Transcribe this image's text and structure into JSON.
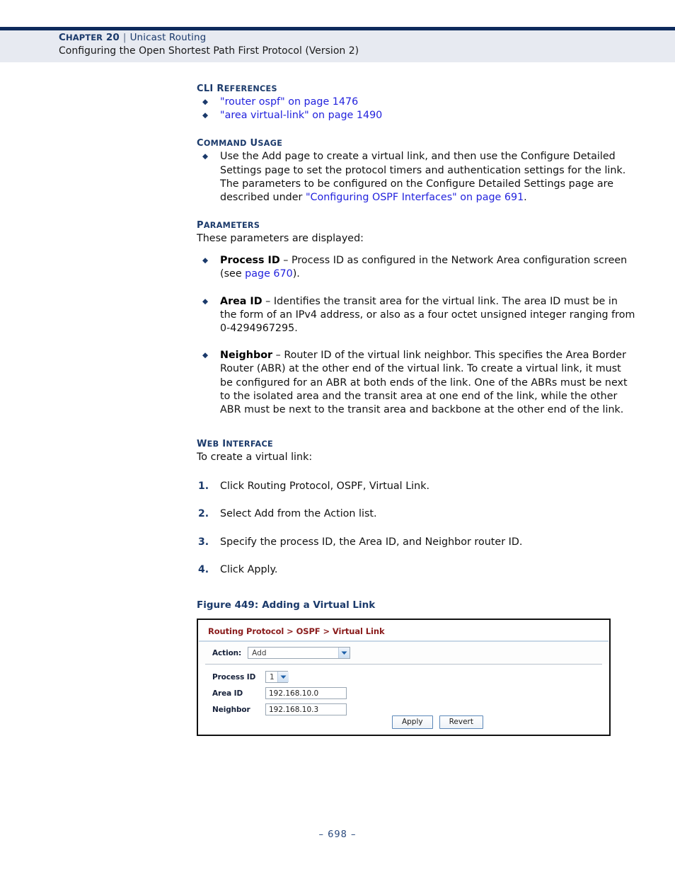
{
  "header": {
    "chapter_label": "CHAPTER 20",
    "separator": "|",
    "topic": "Unicast Routing",
    "subtitle": "Configuring the Open Shortest Path First Protocol (Version 2)"
  },
  "sections": {
    "cli_references": {
      "heading": "CLI REFERENCES",
      "items": [
        "\"router ospf\" on page 1476",
        "\"area virtual-link\" on page 1490"
      ]
    },
    "command_usage": {
      "heading": "COMMAND USAGE",
      "item_text_before": "Use the Add page to create a virtual link, and then use the Configure Detailed Settings page to set the protocol timers and authentication settings for the link. The parameters to be configured on the Configure Detailed Settings page are described under ",
      "item_link": "\"Configuring OSPF Interfaces\" on page 691",
      "item_text_after": "."
    },
    "parameters": {
      "heading": "PARAMETERS",
      "intro": "These parameters are displayed:",
      "items": [
        {
          "term": "Process ID",
          "text_before": " – Process ID as configured in the Network Area configuration screen (see ",
          "link": "page 670",
          "text_after": ")."
        },
        {
          "term": "Area ID",
          "text_before": " – Identifies the transit area for the virtual link. The area ID must be in the form of an IPv4 address, or also as a four octet unsigned integer ranging from 0-4294967295.",
          "link": "",
          "text_after": ""
        },
        {
          "term": "Neighbor",
          "text_before": " – Router ID of the virtual link neighbor. This specifies the Area Border Router (ABR) at the other end of the virtual link. To create a virtual link, it must be configured for an ABR at both ends of the link. One of the ABRs must be next to the isolated area and the transit area at one end of the link, while the other ABR must be next to the transit area and backbone at the other end of the link.",
          "link": "",
          "text_after": ""
        }
      ]
    },
    "web_interface": {
      "heading": "WEB INTERFACE",
      "intro": "To create a virtual link:",
      "steps": [
        {
          "num": "1.",
          "text": "Click Routing Protocol, OSPF, Virtual Link."
        },
        {
          "num": "2.",
          "text": "Select Add from the Action list."
        },
        {
          "num": "3.",
          "text": "Specify the process ID, the Area ID, and Neighbor router ID."
        },
        {
          "num": "4.",
          "text": "Click Apply."
        }
      ]
    }
  },
  "figure": {
    "caption_number": "Figure 449:",
    "caption_title": "Adding a Virtual Link",
    "panel": {
      "breadcrumb": "Routing Protocol > OSPF > Virtual Link",
      "action_label": "Action:",
      "action_value": "Add",
      "fields": [
        {
          "label": "Process ID",
          "value": "1",
          "type": "select"
        },
        {
          "label": "Area ID",
          "value": "192.168.10.0",
          "type": "text"
        },
        {
          "label": "Neighbor",
          "value": "192.168.10.3",
          "type": "text"
        }
      ],
      "apply_label": "Apply",
      "revert_label": "Revert"
    }
  },
  "footer": {
    "page_number": "–  698  –"
  },
  "colors": {
    "navy_rule": "#0d2a5c",
    "header_band": "#e7eaf1",
    "heading_blue": "#1b3a6b",
    "link_blue": "#2222dd",
    "breadcrumb_red": "#8a1c1c"
  }
}
